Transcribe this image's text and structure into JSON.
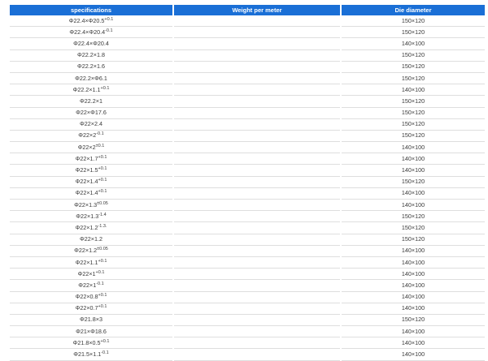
{
  "table": {
    "headers": [
      "specifications",
      "Weight per meter",
      "Die diameter"
    ],
    "rows": [
      {
        "spec": "Φ22.4×Φ20.5",
        "sup": "+0.1",
        "weight": "",
        "die": "150×120"
      },
      {
        "spec": "Φ22.4×Φ20.4",
        "sup": "-0.1",
        "weight": "",
        "die": "150×120"
      },
      {
        "spec": "Φ22.4×Φ20.4",
        "sup": "",
        "weight": "",
        "die": "140×100"
      },
      {
        "spec": "Φ22.2×1.8",
        "sup": "",
        "weight": "",
        "die": "150×120"
      },
      {
        "spec": "Φ22.2×1.6",
        "sup": "",
        "weight": "",
        "die": "150×120"
      },
      {
        "spec": "Φ22.2×Φ6.1",
        "sup": "",
        "weight": "",
        "die": "150×120"
      },
      {
        "spec": "Φ22.2×1.1",
        "sup": "+0.1",
        "weight": "",
        "die": "140×100"
      },
      {
        "spec": "Φ22.2×1",
        "sup": "",
        "weight": "",
        "die": "150×120"
      },
      {
        "spec": "Φ22×Φ17.6",
        "sup": "",
        "weight": "",
        "die": "150×120"
      },
      {
        "spec": "Φ22×2.4",
        "sup": "",
        "weight": "",
        "die": "150×120"
      },
      {
        "spec": "Φ22×2",
        "sup": "-0.1",
        "weight": "",
        "die": "150×120"
      },
      {
        "spec": "Φ22×2",
        "sup": "±0.1",
        "weight": "",
        "die": "140×100"
      },
      {
        "spec": "Φ22×1.7",
        "sup": "+0.1",
        "weight": "",
        "die": "140×100"
      },
      {
        "spec": "Φ22×1.5",
        "sup": "+0.1",
        "weight": "",
        "die": "140×100"
      },
      {
        "spec": "Φ22×1.4",
        "sup": "+0.1",
        "weight": "",
        "die": "150×120"
      },
      {
        "spec": "Φ22×1.4",
        "sup": "+0.1",
        "weight": "",
        "die": "140×100"
      },
      {
        "spec": "Φ22×1.3",
        "sup": "±0.05",
        "weight": "",
        "die": "140×100"
      },
      {
        "spec": "Φ22×1.3",
        "sup": "-1.4",
        "weight": "",
        "die": "150×120"
      },
      {
        "spec": "Φ22×1.2",
        "sup": "-1.3.",
        "weight": "",
        "die": "150×120"
      },
      {
        "spec": "Φ22×1.2",
        "sup": "",
        "weight": "",
        "die": "150×120"
      },
      {
        "spec": "Φ22×1.2",
        "sup": "±0.05",
        "weight": "",
        "die": "140×100"
      },
      {
        "spec": "Φ22×1.1",
        "sup": "+0.1",
        "weight": "",
        "die": "140×100"
      },
      {
        "spec": "Φ22×1",
        "sup": "+0.1",
        "weight": "",
        "die": "140×100"
      },
      {
        "spec": "Φ22×1",
        "sup": "-0.1",
        "weight": "",
        "die": "140×100"
      },
      {
        "spec": "Φ22×0.8",
        "sup": "+0.1",
        "weight": "",
        "die": "140×100"
      },
      {
        "spec": "Φ22×0.7",
        "sup": "+0.1",
        "weight": "",
        "die": "140×100"
      },
      {
        "spec": "Φ21.8×3",
        "sup": "",
        "weight": "",
        "die": "150×120"
      },
      {
        "spec": "Φ21×Φ18.6",
        "sup": "",
        "weight": "",
        "die": "140×100"
      },
      {
        "spec": "Φ21.8×0.5",
        "sup": "+0.1",
        "weight": "",
        "die": "140×100"
      },
      {
        "spec": "Φ21.5×1.1",
        "sup": "-0.1",
        "weight": "",
        "die": "140×100"
      }
    ]
  }
}
